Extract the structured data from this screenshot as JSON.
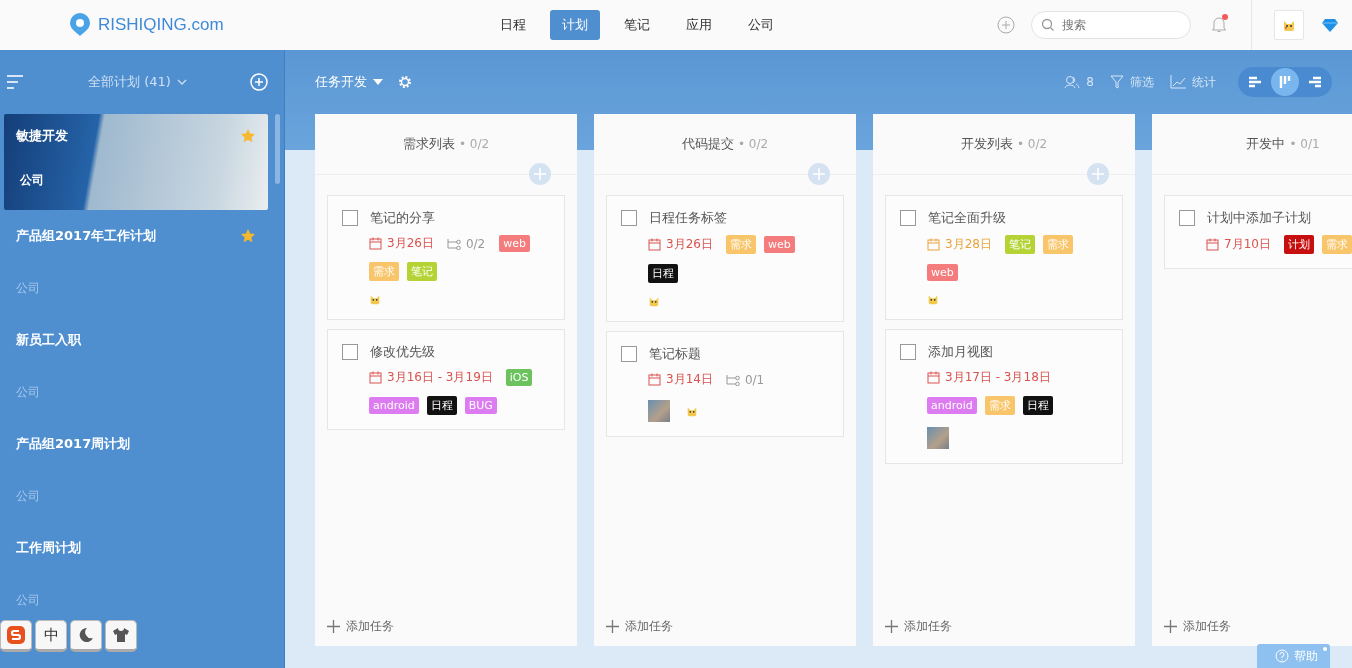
{
  "header": {
    "logo": "RISHIQING.com",
    "nav": [
      {
        "label": "日程",
        "selected": false
      },
      {
        "label": "计划",
        "selected": true
      },
      {
        "label": "笔记",
        "selected": false
      },
      {
        "label": "应用",
        "selected": false
      },
      {
        "label": "公司",
        "selected": false
      }
    ],
    "search": {
      "placeholder": "搜索"
    },
    "unread": true
  },
  "sidebar": {
    "title": "全部计划 (41)",
    "plans": [
      {
        "title": "敏捷开发",
        "group": "公司",
        "starred": true,
        "selected": true
      },
      {
        "title": "产品组2017年工作计划",
        "group": "公司",
        "starred": true,
        "selected": false
      },
      {
        "title": "新员工入职",
        "group": "公司",
        "starred": false,
        "selected": false
      },
      {
        "title": "产品组2017周计划",
        "group": "公司",
        "starred": false,
        "selected": false
      },
      {
        "title": "工作周计划",
        "group": "公司",
        "starred": false,
        "selected": false
      }
    ]
  },
  "board": {
    "title": "任务开发",
    "members": "8",
    "filter": "筛选",
    "stats": "统计",
    "views": [
      {
        "kind": "gantt",
        "selected": false
      },
      {
        "kind": "board",
        "selected": true
      },
      {
        "kind": "list",
        "selected": false
      }
    ],
    "columns": [
      {
        "name": "需求列表",
        "count": "• 0/2",
        "add_task": "添加任务",
        "tasks": [
          {
            "title": "笔记的分享",
            "done": false,
            "date": {
              "text": "3月26日",
              "color": "#d9534f"
            },
            "subtasks": "0/2",
            "tags": [
              {
                "label": "web",
                "color": "#f47c7c"
              },
              {
                "label": "需求",
                "color": "#f8c56a"
              },
              {
                "label": "笔记",
                "color": "#b5d334"
              }
            ],
            "members": [
              {
                "kind": "avatar"
              }
            ]
          },
          {
            "title": "修改优先级",
            "done": false,
            "date": {
              "text": "3月16日 - 3月19日",
              "color": "#d9534f"
            },
            "tags": [
              {
                "label": "iOS",
                "color": "#6cc35e"
              },
              {
                "label": "android",
                "color": "#dd7cf0"
              },
              {
                "label": "日程",
                "color": "#111111"
              },
              {
                "label": "BUG",
                "color": "#dd7cf0"
              }
            ]
          }
        ]
      },
      {
        "name": "代码提交",
        "count": "• 0/2",
        "add_task": "添加任务",
        "tasks": [
          {
            "title": "日程任务标签",
            "done": false,
            "date": {
              "text": "3月26日",
              "color": "#d9534f"
            },
            "tags": [
              {
                "label": "需求",
                "color": "#f8c56a"
              },
              {
                "label": "web",
                "color": "#f47c7c"
              },
              {
                "label": "日程",
                "color": "#111111"
              }
            ],
            "members": [
              {
                "kind": "avatar"
              }
            ]
          },
          {
            "title": "笔记标题",
            "done": false,
            "date": {
              "text": "3月14日",
              "color": "#d9534f"
            },
            "subtasks": "0/1",
            "members": [
              {
                "kind": "photo"
              },
              {
                "kind": "avatar"
              }
            ]
          }
        ]
      },
      {
        "name": "开发列表",
        "count": "• 0/2",
        "add_task": "添加任务",
        "tasks": [
          {
            "title": "笔记全面升级",
            "done": false,
            "date": {
              "text": "3月28日",
              "color": "#e8a33c"
            },
            "tags": [
              {
                "label": "笔记",
                "color": "#b5d334"
              },
              {
                "label": "需求",
                "color": "#f8c56a"
              },
              {
                "label": "web",
                "color": "#f47c7c"
              }
            ],
            "members": [
              {
                "kind": "avatar"
              }
            ]
          },
          {
            "title": "添加月视图",
            "done": false,
            "date": {
              "text": "3月17日 - 3月18日",
              "color": "#d9534f"
            },
            "tags": [
              {
                "label": "android",
                "color": "#dd7cf0"
              },
              {
                "label": "需求",
                "color": "#f8c56a"
              },
              {
                "label": "日程",
                "color": "#111111"
              }
            ],
            "members": [
              {
                "kind": "photo"
              }
            ]
          }
        ]
      },
      {
        "name": "开发中",
        "count": "• 0/1",
        "add_task": "添加任务",
        "tasks": [
          {
            "title": "计划中添加子计划",
            "done": false,
            "date": {
              "text": "7月10日",
              "color": "#d9534f"
            },
            "tags": [
              {
                "label": "计划",
                "color": "#c80f0f"
              },
              {
                "label": "需求",
                "color": "#f8c56a"
              }
            ]
          }
        ]
      }
    ]
  },
  "ime": {
    "mode": "中"
  },
  "help": "帮助"
}
